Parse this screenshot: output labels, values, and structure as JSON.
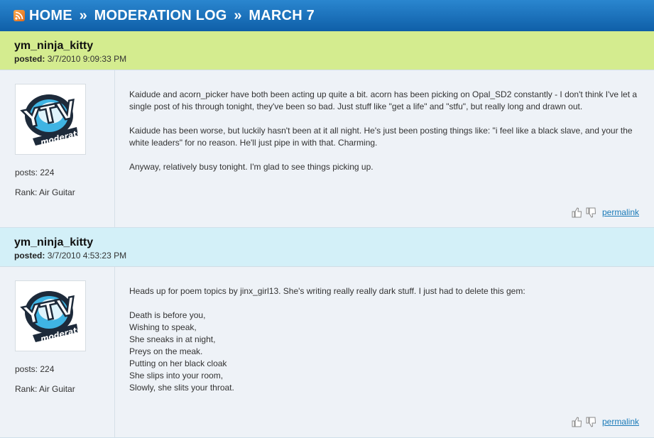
{
  "breadcrumb": {
    "home": "HOME",
    "separator": "»",
    "section": "MODERATION LOG",
    "current": "MARCH 7"
  },
  "posts": [
    {
      "author": "ym_ninja_kitty",
      "posted_label": "posted:",
      "posted_value": "3/7/2010 9:09:33 PM",
      "header_color": "#d4ec8f",
      "posts_count": "posts: 224",
      "rank": "Rank: Air Guitar",
      "avatar_text": "moderator",
      "paragraphs": [
        "Kaidude and acorn_picker have both been acting up quite a bit. acorn has been picking on Opal_SD2 constantly - I don't think I've let a single post of his through tonight, they've been so bad. Just stuff like \"get a life\" and \"stfu\", but really long and drawn out.",
        "Kaidude has been worse, but luckily hasn't been at it all night. He's just been posting things like: \"i feel like a black slave, and your the white leaders\" for no reason. He'll just pipe in with that. Charming.",
        "Anyway, relatively busy tonight. I'm glad to see things picking up."
      ],
      "permalink": "permalink"
    },
    {
      "author": "ym_ninja_kitty",
      "posted_label": "posted:",
      "posted_value": "3/7/2010 4:53:23 PM",
      "header_color": "#d3f0f8",
      "posts_count": "posts: 224",
      "rank": "Rank: Air Guitar",
      "avatar_text": "moderator",
      "intro": "Heads up for poem topics by jinx_girl13. She's writing really really dark stuff. I just had to delete this gem:",
      "poem": [
        "Death is before you,",
        "Wishing to speak,",
        "She sneaks in at night,",
        "Preys on the meak.",
        "Putting on her black cloak",
        "She slips into your room,",
        "Slowly, she slits your throat."
      ],
      "permalink": "permalink"
    }
  ]
}
